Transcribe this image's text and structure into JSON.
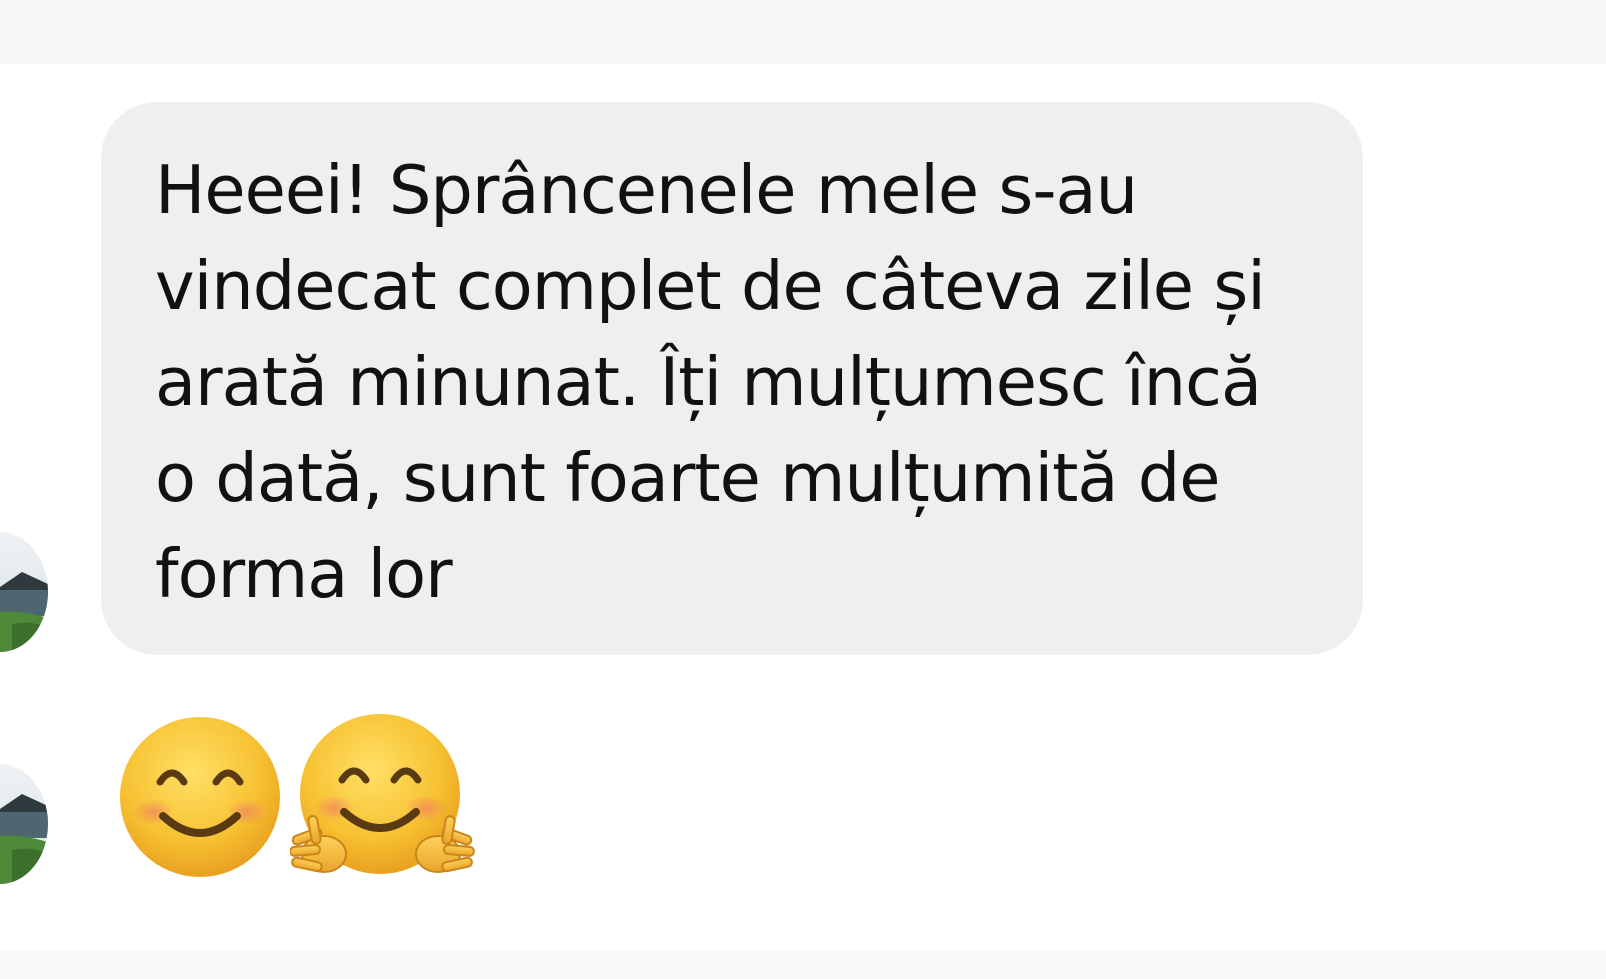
{
  "conversation": {
    "messages": [
      {
        "sender": "contact",
        "type": "text",
        "text": "Heeei! Sprâncenele  mele s-au\nvindecat complet de câteva zile și\narată minunat. Îți mulțumesc încă\no dată, sunt foarte mulțumită de\nforma lor"
      },
      {
        "sender": "contact",
        "type": "emoji",
        "emojis": [
          "smiling-face-with-smiling-eyes",
          "hugging-face"
        ]
      }
    ]
  },
  "colors": {
    "bubble_background": "#efefef",
    "text": "#111111",
    "emoji_face": "#f7c233",
    "emoji_blush": "#f28a5b"
  },
  "icons": {
    "avatar": "landscape-photo-avatar",
    "emoji_1": "smiling-face-with-smiling-eyes",
    "emoji_2": "hugging-face"
  }
}
